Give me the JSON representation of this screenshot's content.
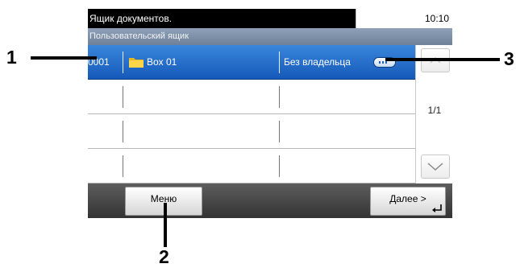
{
  "status_bar": {
    "title": "Ящик документов.",
    "time": "10:10"
  },
  "sub_header": {
    "title": "Пользовательский ящик"
  },
  "list": {
    "rows": [
      {
        "number": "0001",
        "name": "Box 01",
        "owner": "Без владельца",
        "selected": true
      },
      {
        "number": "",
        "name": "",
        "owner": "",
        "selected": false
      },
      {
        "number": "",
        "name": "",
        "owner": "",
        "selected": false
      },
      {
        "number": "",
        "name": "",
        "owner": "",
        "selected": false
      }
    ]
  },
  "scroll": {
    "page_indicator": "1/1"
  },
  "bottom_bar": {
    "menu_label": "Меню",
    "next_label": "Далее >"
  },
  "callouts": [
    "1",
    "2",
    "3"
  ],
  "colors": {
    "selected_row": "#1f6fd0",
    "header": "#7d8ea6"
  },
  "icons": [
    "folder-icon",
    "details-pill-icon",
    "scroll-up-icon",
    "scroll-down-icon",
    "enter-icon"
  ]
}
